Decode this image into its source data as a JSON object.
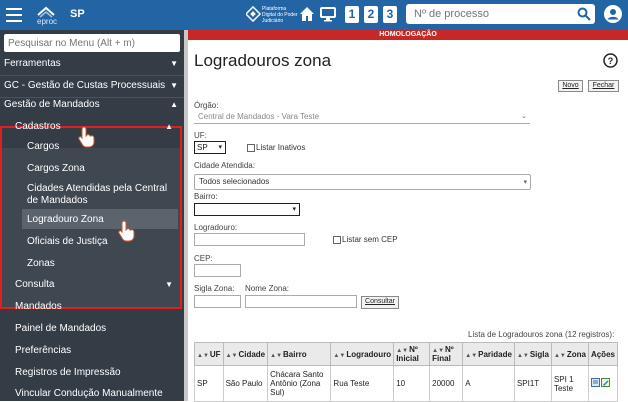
{
  "header": {
    "app_logo_text": "eproc",
    "state": "SP",
    "pdpj_text": "Plataforma Digital do Poder Judiciário",
    "shortcuts": [
      "1",
      "2",
      "3"
    ],
    "search_placeholder": "Nº de processo"
  },
  "sidebar": {
    "search_placeholder": "Pesquisar no Menu (Alt + m)",
    "items": {
      "ferramentas": "Ferramentas",
      "gc": "GC - Gestão de Custas Processuais",
      "gestao": "Gestão de Mandados",
      "cadastros": "Cadastros",
      "cargos": "Cargos",
      "cargos_zona": "Cargos Zona",
      "cidades": "Cidades Atendidas pela Central de Mandados",
      "logradouro_zona": "Logradouro Zona",
      "oficiais": "Oficiais de Justiça",
      "zonas": "Zonas",
      "consulta": "Consulta",
      "mandados": "Mandados",
      "painel": "Painel de Mandados",
      "preferencias": "Preferências",
      "registros": "Registros de Impressão",
      "vincular": "Vincular Condução Manualmente"
    }
  },
  "banner": "HOMOLOGAÇÃO",
  "main": {
    "title": "Logradouros zona",
    "btn_novo": "Novo",
    "btn_fechar": "Fechar",
    "orgao_label": "Órgão:",
    "orgao_value": "Central de Mandados - Vara Teste",
    "uf_label": "UF:",
    "uf_value": "SP",
    "listar_inativos": "Listar Inativos",
    "cidade_label": "Cidade Atendida:",
    "cidade_value": "Todos selecionados",
    "bairro_label": "Bairro:",
    "logradouro_label": "Logradouro:",
    "listar_sem_cep": "Listar sem CEP",
    "cep_label": "CEP:",
    "sigla_zona_label": "Sigla Zona:",
    "nome_zona_label": "Nome Zona:",
    "consultar": "Consultar",
    "list_info": "Lista de Logradouros zona (12 registros):"
  },
  "table": {
    "headers": [
      "UF",
      "Cidade",
      "Bairro",
      "Logradouro",
      "Nº Inicial",
      "Nº Final",
      "Paridade",
      "Sigla",
      "Zona",
      "Ações"
    ],
    "rows": [
      [
        "SP",
        "São Paulo",
        "Chácara Santo Antônio (Zona Sul)",
        "Rua Teste",
        "10",
        "20000",
        "A",
        "SPI1T",
        "SPI 1 Teste"
      ]
    ]
  },
  "colors": {
    "topbar": "#2364a4",
    "sidebar": "#343c46",
    "homolog": "#c62828",
    "highlight_border": "#e02020"
  }
}
